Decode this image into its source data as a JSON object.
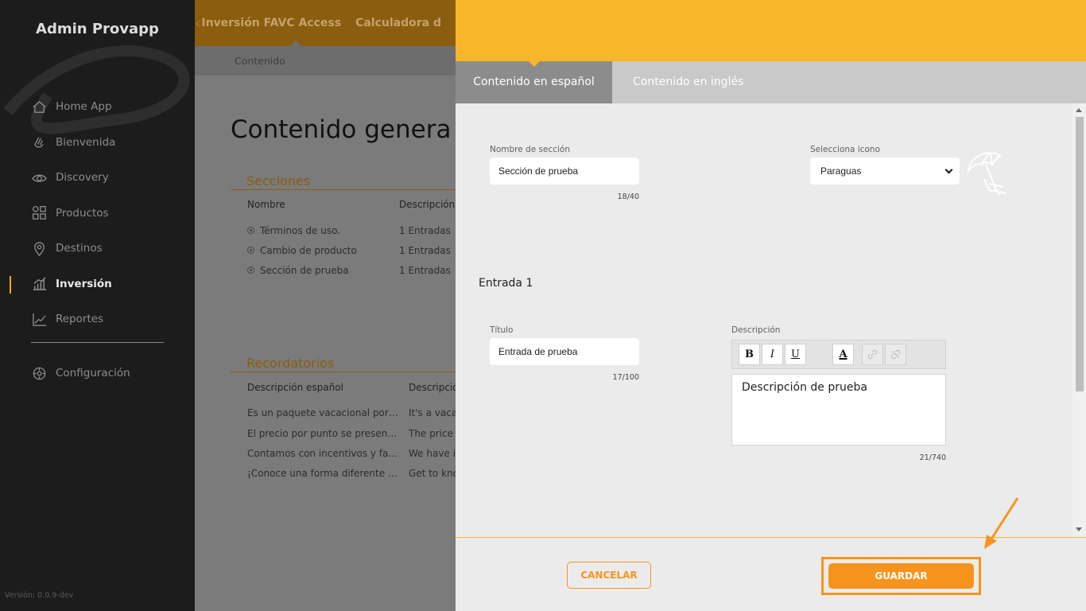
{
  "sidebar": {
    "title": "Admin Provapp",
    "items": [
      {
        "label": "Home App",
        "icon": "home-icon"
      },
      {
        "label": "Bienvenida",
        "icon": "hand-wave-icon"
      },
      {
        "label": "Discovery",
        "icon": "eye-icon"
      },
      {
        "label": "Productos",
        "icon": "grid-icon"
      },
      {
        "label": "Destinos",
        "icon": "location-pin-icon"
      },
      {
        "label": "Inversión",
        "icon": "bar-chart-icon",
        "active": true
      },
      {
        "label": "Reportes",
        "icon": "line-chart-icon"
      }
    ],
    "config_label": "Configuración",
    "version": "Versión: 0.0.9-dev"
  },
  "page": {
    "tabs": [
      "Inversión FAVC Access",
      "Calculadora d"
    ],
    "subtab": "Contenido",
    "title": "Contenido genera",
    "sections_header": "Secciones",
    "sections_columns": [
      "Nombre",
      "Descripción"
    ],
    "sections_rows": [
      {
        "name": "Términos de uso.",
        "desc": "1 Entradas"
      },
      {
        "name": "Cambio de producto",
        "desc": "1 Entradas"
      },
      {
        "name": "Sección de prueba",
        "desc": "1 Entradas"
      }
    ],
    "reminders_header": "Recordatorios",
    "reminders_columns": [
      "Descripción español",
      "Descripció"
    ],
    "reminders_rows": [
      {
        "es": "Es un paquete vacacional por…",
        "en": "It's a vaca"
      },
      {
        "es": "El precio por punto se presen…",
        "en": "The price p"
      },
      {
        "es": "Contamos con incentivos y fa…",
        "en": "We have in"
      },
      {
        "es": "¡Conoce una forma diferente …",
        "en": "Get to kno"
      }
    ]
  },
  "modal": {
    "tabs": {
      "spanish": "Contenido en español",
      "english": "Contenido en inglés"
    },
    "section_name_label": "Nombre de sección",
    "section_name_value": "Sección de prueba",
    "section_name_counter": "18/40",
    "icon_label": "Selecciona icono",
    "icon_value": "Paraguas",
    "entry_title": "Entrada 1",
    "title_label": "Título",
    "title_value": "Entrada de prueba",
    "title_counter": "17/100",
    "desc_label": "Descripción",
    "desc_value": "Descripción de prueba",
    "desc_counter": "21/740",
    "toolbar": {
      "bold": "B",
      "italic": "I",
      "underline": "U",
      "color": "A"
    },
    "cancel": "CANCELAR",
    "save": "GUARDAR"
  },
  "colors": {
    "accent": "#f8b62a",
    "button_orange": "#f7941d",
    "sidebar_bg": "#1c1c1c"
  }
}
